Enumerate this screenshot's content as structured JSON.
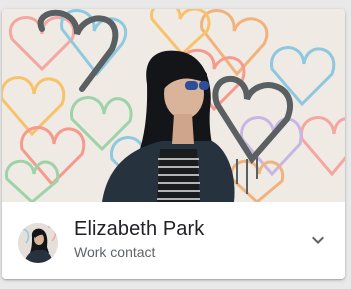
{
  "contact": {
    "name": "Elizabeth Park",
    "subtitle": "Work contact"
  },
  "icons": {
    "expand": "chevron-down-icon"
  },
  "colors": {
    "card_background": "#ffffff",
    "page_background": "#e9e9e9",
    "name_text": "#202124",
    "subtitle_text": "#5f6368",
    "chevron": "#5f6368"
  }
}
